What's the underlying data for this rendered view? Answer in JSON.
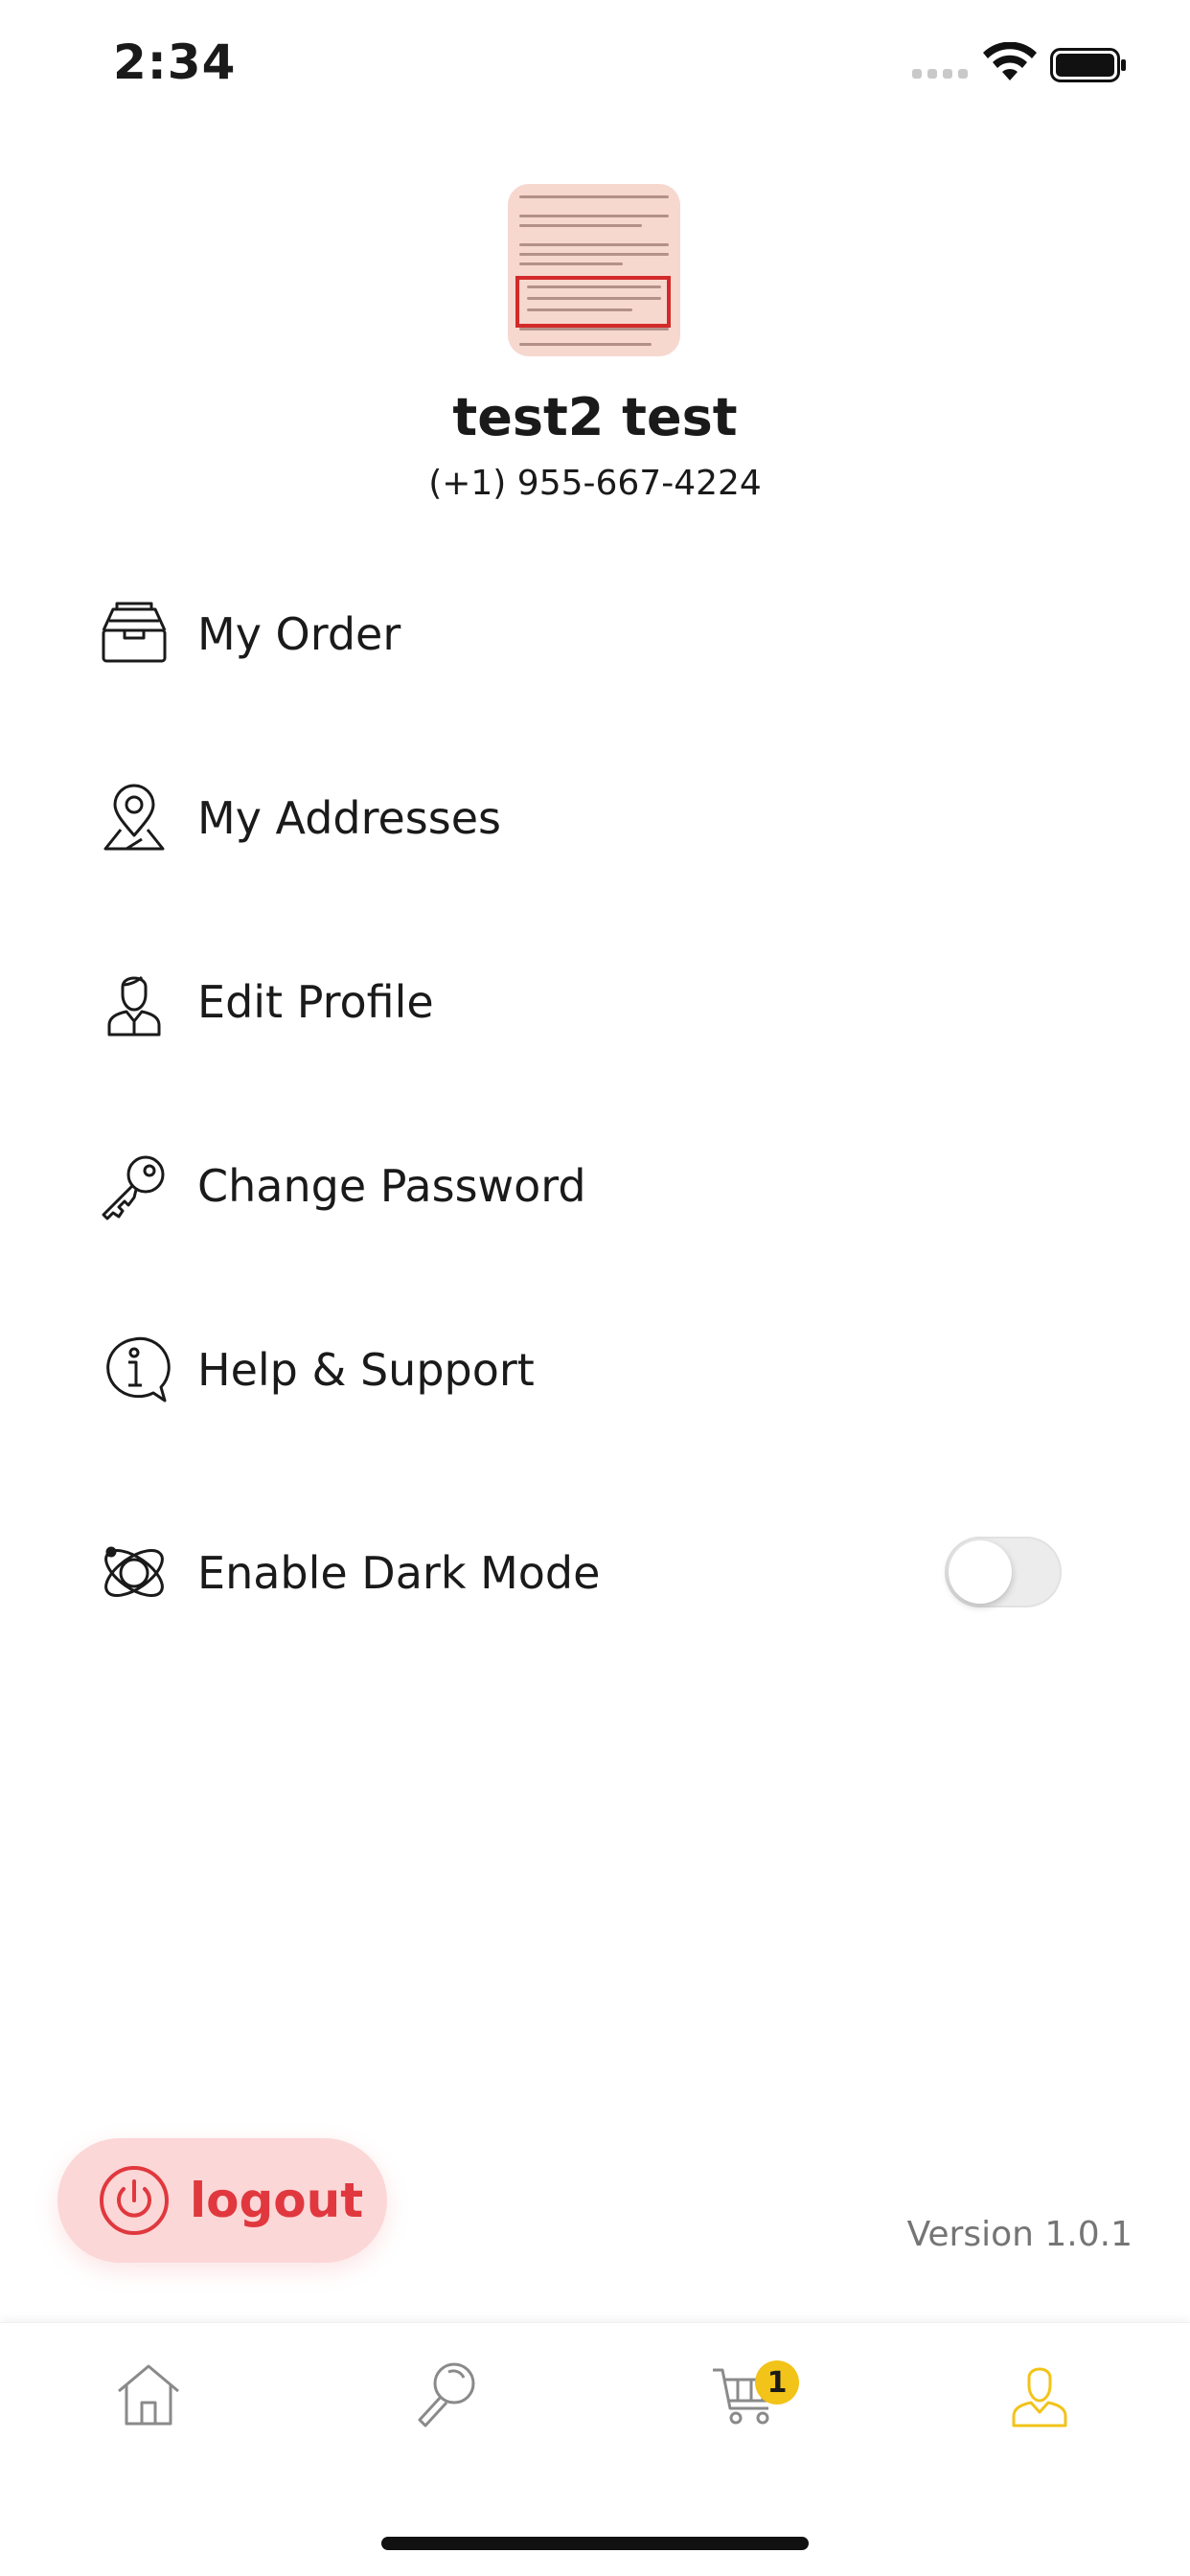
{
  "status_bar": {
    "time": "2:34"
  },
  "profile": {
    "name": "test2 test",
    "phone": "(+1) 955-667-4224"
  },
  "menu": {
    "items": [
      {
        "label": "My Order",
        "icon": "order-tray-icon"
      },
      {
        "label": "My Addresses",
        "icon": "map-pin-icon"
      },
      {
        "label": "Edit Profile",
        "icon": "user-profile-icon"
      },
      {
        "label": "Change Password",
        "icon": "key-icon"
      },
      {
        "label": "Help & Support",
        "icon": "info-chat-icon"
      },
      {
        "label": "Enable Dark Mode",
        "icon": "orbit-icon"
      }
    ],
    "dark_mode_enabled": false
  },
  "logout": {
    "label": "logout",
    "icon": "power-icon"
  },
  "version": "Version 1.0.1",
  "tabbar": {
    "items": [
      {
        "name": "home",
        "icon": "home-icon",
        "active": false
      },
      {
        "name": "search",
        "icon": "search-icon",
        "active": false
      },
      {
        "name": "cart",
        "icon": "cart-icon",
        "active": false
      },
      {
        "name": "profile",
        "icon": "profile-icon",
        "active": true
      }
    ],
    "cart_badge": "1"
  },
  "colors": {
    "accent": "#f2c318",
    "logout_text": "#e0383e",
    "logout_bg": "#fcd7d7",
    "text": "#1a1a1a"
  }
}
